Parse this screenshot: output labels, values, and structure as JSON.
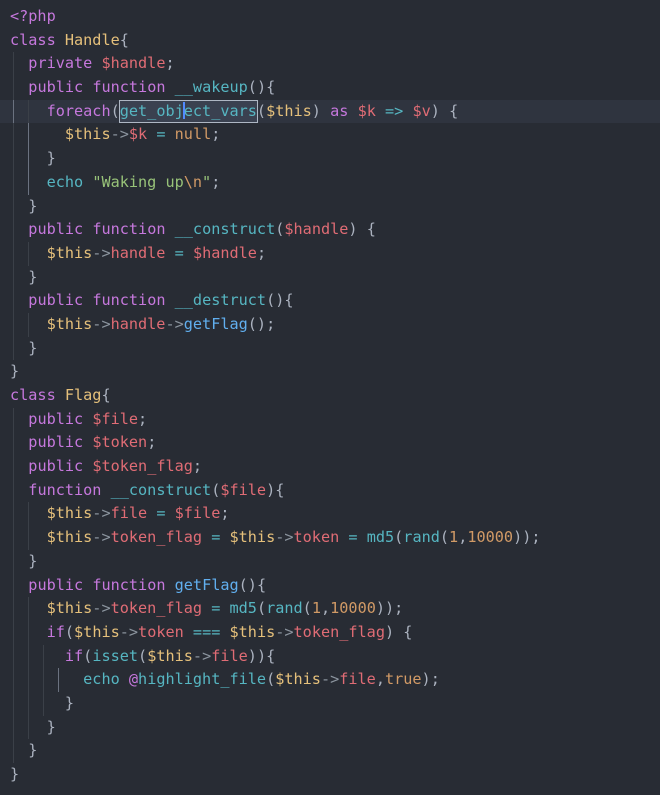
{
  "editor": {
    "language": "php",
    "theme_name": "One Dark",
    "background_color": "#282c34",
    "active_line_color": "#2f343f",
    "caret_color": "#528bff",
    "selection_color": "#3a4150",
    "indent_guide_color": "#3b4048",
    "active_indent_guide_color": "#6b7280",
    "active_line_index": 4,
    "selected_token": "get_object_vars",
    "caret_offset_in_token": 7
  },
  "palette": {
    "keyword": "#c678dd",
    "class_name": "#e5c07b",
    "function": "#61afef",
    "builtin": "#56b6c2",
    "variable": "#e06c75",
    "this_variable": "#e5c07b",
    "operator": "#56b6c2",
    "string": "#98c379",
    "number": "#d19a66",
    "constant": "#d19a66",
    "punctuation": "#abb2bf",
    "arrow": "#8b949e"
  },
  "code": {
    "lines": [
      "<?php",
      "class Handle{",
      "  private $handle;",
      "  public function __wakeup(){",
      "    foreach(get_object_vars($this) as $k => $v) {",
      "      $this->$k = null;",
      "    }",
      "    echo \"Waking up\\n\";",
      "  }",
      "  public function __construct($handle) {",
      "    $this->handle = $handle;",
      "  }",
      "  public function __destruct(){",
      "    $this->handle->getFlag();",
      "  }",
      "}",
      "class Flag{",
      "  public $file;",
      "  public $token;",
      "  public $token_flag;",
      "  function __construct($file){",
      "    $this->file = $file;",
      "    $this->token_flag = $this->token = md5(rand(1,10000));",
      "  }",
      "  public function getFlag(){",
      "    $this->token_flag = md5(rand(1,10000));",
      "    if($this->token === $this->token_flag) {",
      "      if(isset($this->file)){",
      "        echo @highlight_file($this->file,true);",
      "      }",
      "    }",
      "  }",
      "}"
    ],
    "line_count": 33,
    "identifiers": {
      "classes": [
        "Handle",
        "Flag"
      ],
      "methods": [
        "__wakeup",
        "__construct",
        "__destruct",
        "getFlag"
      ],
      "properties": [
        "handle",
        "file",
        "token",
        "token_flag"
      ],
      "builtins": [
        "get_object_vars",
        "isset",
        "md5",
        "rand",
        "highlight_file",
        "echo"
      ],
      "variables": [
        "$handle",
        "$this",
        "$k",
        "$v",
        "$file"
      ],
      "literals": [
        "null",
        "\"Waking up\\n\"",
        "1",
        "10000",
        "true"
      ]
    }
  }
}
